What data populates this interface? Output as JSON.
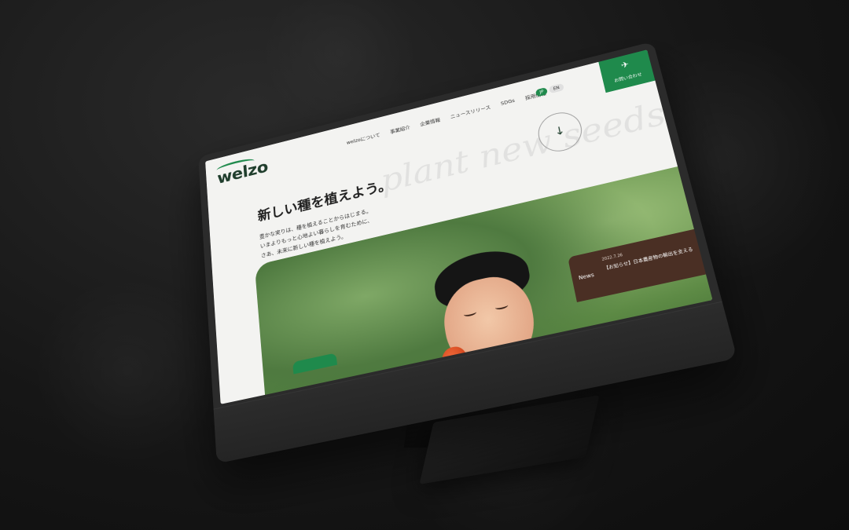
{
  "logo": {
    "text": "welzo"
  },
  "nav": {
    "items": [
      "welzoについて",
      "事業紹介",
      "企業情報",
      "ニュースリリース",
      "SDGs",
      "採用情報"
    ]
  },
  "lang": {
    "jp": "JP",
    "en": "EN"
  },
  "contact": {
    "label": "お問い合わせ"
  },
  "hero": {
    "headline": "新しい種を植えよう。",
    "body": [
      "豊かな実りは、種を植えることからはじまる。",
      "いまよりもっと心地よい暮らしを育むために、",
      "さあ、未来に新しい種を植えよう。"
    ],
    "background_script": "plant new seeds"
  },
  "news": {
    "tag": "News",
    "date": "2022.7.26",
    "title": "【お知らせ】日本農産物の輸出を支える"
  },
  "colors": {
    "brand_green": "#1f8a4c",
    "logo_dark": "#1f3d2c",
    "news_brown": "#4a2f24",
    "page_bg": "#f3f3f1"
  },
  "icons": {
    "contact": "paper-plane-icon",
    "badge": "down-arrow-icon"
  }
}
